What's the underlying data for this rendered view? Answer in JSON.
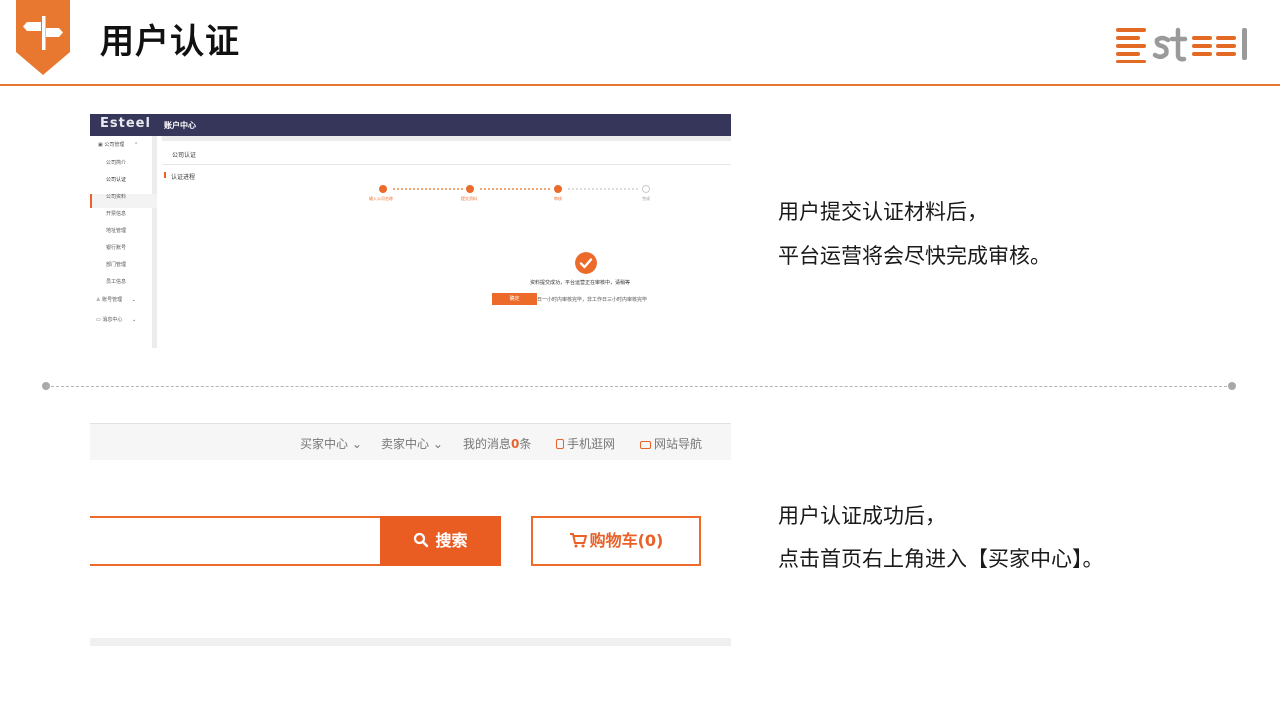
{
  "slide": {
    "title": "用户认证",
    "logo_text": "Esteel",
    "badge_icon": "signpost-icon",
    "accent_color": "#e8782f"
  },
  "screenshot1": {
    "brand": "Esteel",
    "header_title": "账户中心",
    "sidebar": [
      {
        "label": "公司管理",
        "icon": "building-icon",
        "group": true
      },
      {
        "label": "公司简介"
      },
      {
        "label": "公司认证",
        "active": true
      },
      {
        "label": "公司资料"
      },
      {
        "label": "开票信息"
      },
      {
        "label": "地址管理"
      },
      {
        "label": "银行账号"
      },
      {
        "label": "部门管理"
      },
      {
        "label": "员工信息"
      },
      {
        "label": "账号管理",
        "icon": "user-icon",
        "group": true
      },
      {
        "label": "消息中心",
        "icon": "message-icon",
        "group": true
      }
    ],
    "breadcrumb": "公司认证",
    "section_title": "认证进程",
    "steps": [
      {
        "label": "输入公司名称",
        "state": "done"
      },
      {
        "label": "提交资料",
        "state": "done"
      },
      {
        "label": "审核",
        "state": "current"
      },
      {
        "label": "完成",
        "state": "todo"
      }
    ],
    "message": "资料提交成功，平台运营正在审核中，请稍等",
    "tip": "提示：工作日一小时内审核完毕，非工作日三小时内审核完毕",
    "confirm_button": "确定"
  },
  "screenshot2": {
    "nav": {
      "buyer_center": "买家中心",
      "seller_center": "卖家中心",
      "messages_prefix": "我的消息",
      "messages_count": "0",
      "messages_suffix": "条",
      "mobile": "手机逛网",
      "site_nav": "网站导航"
    },
    "search_button": "搜索",
    "cart_label": "购物车(0)"
  },
  "captions": {
    "top_line1": "用户提交认证材料后，",
    "top_line2": "平台运营将会尽快完成审核。",
    "bottom_line1": "用户认证成功后，",
    "bottom_line2": "点击首页右上角进入【买家中心】。"
  }
}
